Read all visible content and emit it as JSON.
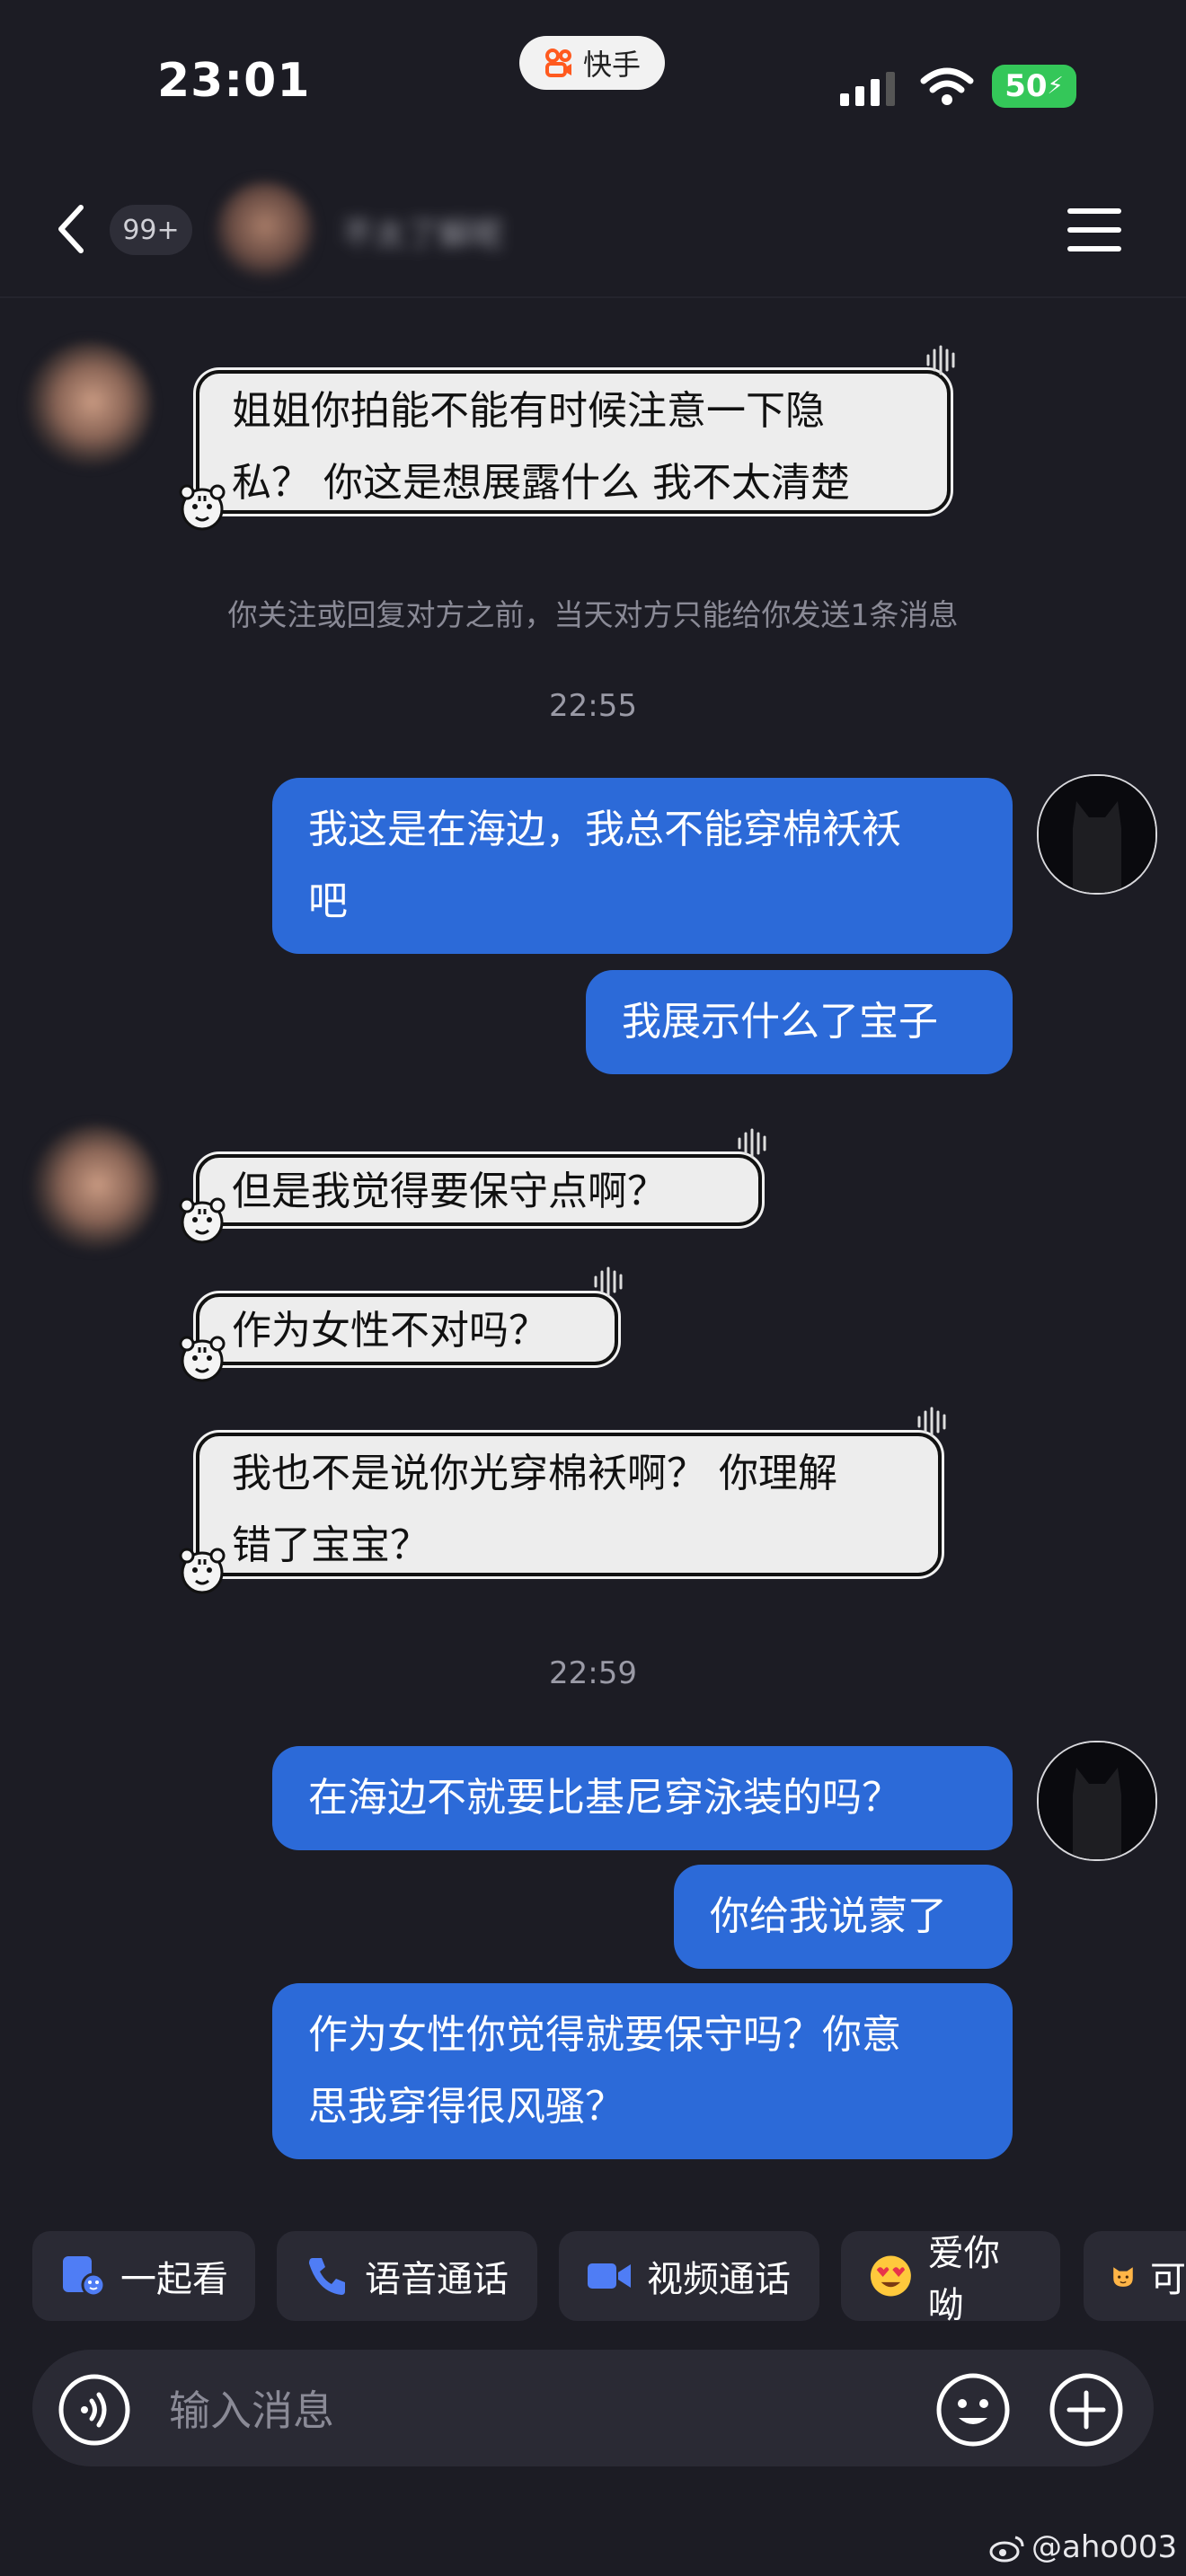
{
  "status_bar": {
    "time": "23:01",
    "app_pill_label": "快手",
    "battery": "50"
  },
  "nav": {
    "unread_count": "99+",
    "contact_name": "不太了解呢"
  },
  "notice": "你关注或回复对方之前，当天对方只能给你发送1条消息",
  "messages": [
    {
      "from": "her",
      "text_lines": [
        "姐姐你拍能不能有时候注意一下隐",
        "私？ 你这是想展露什么 我不太清楚"
      ]
    },
    {
      "from": "me",
      "text_lines": [
        "我这是在海边，我总不能穿棉袄袄",
        "吧"
      ]
    },
    {
      "from": "me",
      "text_lines": [
        "我展示什么了宝子"
      ]
    },
    {
      "from": "her",
      "text_lines": [
        "但是我觉得要保守点啊？"
      ]
    },
    {
      "from": "her",
      "text_lines": [
        "作为女性不对吗？"
      ]
    },
    {
      "from": "her",
      "text_lines": [
        "我也不是说你光穿棉袄啊？ 你理解",
        "错了宝宝？"
      ]
    },
    {
      "from": "me",
      "text_lines": [
        "在海边不就要比基尼穿泳装的吗？"
      ]
    },
    {
      "from": "me",
      "text_lines": [
        "你给我说蒙了"
      ]
    },
    {
      "from": "me",
      "text_lines": [
        "作为女性你觉得就要保守吗？你意",
        "思我穿得很风骚？"
      ]
    }
  ],
  "timestamps": [
    "22:55",
    "22:59"
  ],
  "quick_actions": [
    {
      "label": "一起看",
      "icon": "watch-together-icon"
    },
    {
      "label": "语音通话",
      "icon": "phone-icon"
    },
    {
      "label": "视频通话",
      "icon": "video-camera-icon"
    },
    {
      "label": "爱你呦",
      "icon": "heart-eyes-emoji-icon"
    },
    {
      "label": "可",
      "icon": "cat-emoji-icon"
    }
  ],
  "input": {
    "placeholder": "输入消息"
  },
  "watermark": "@aho003",
  "colors": {
    "background": "#1c1c24",
    "my_bubble": "#2c6ad8",
    "her_bubble": "#ededed",
    "battery": "#34c759"
  }
}
